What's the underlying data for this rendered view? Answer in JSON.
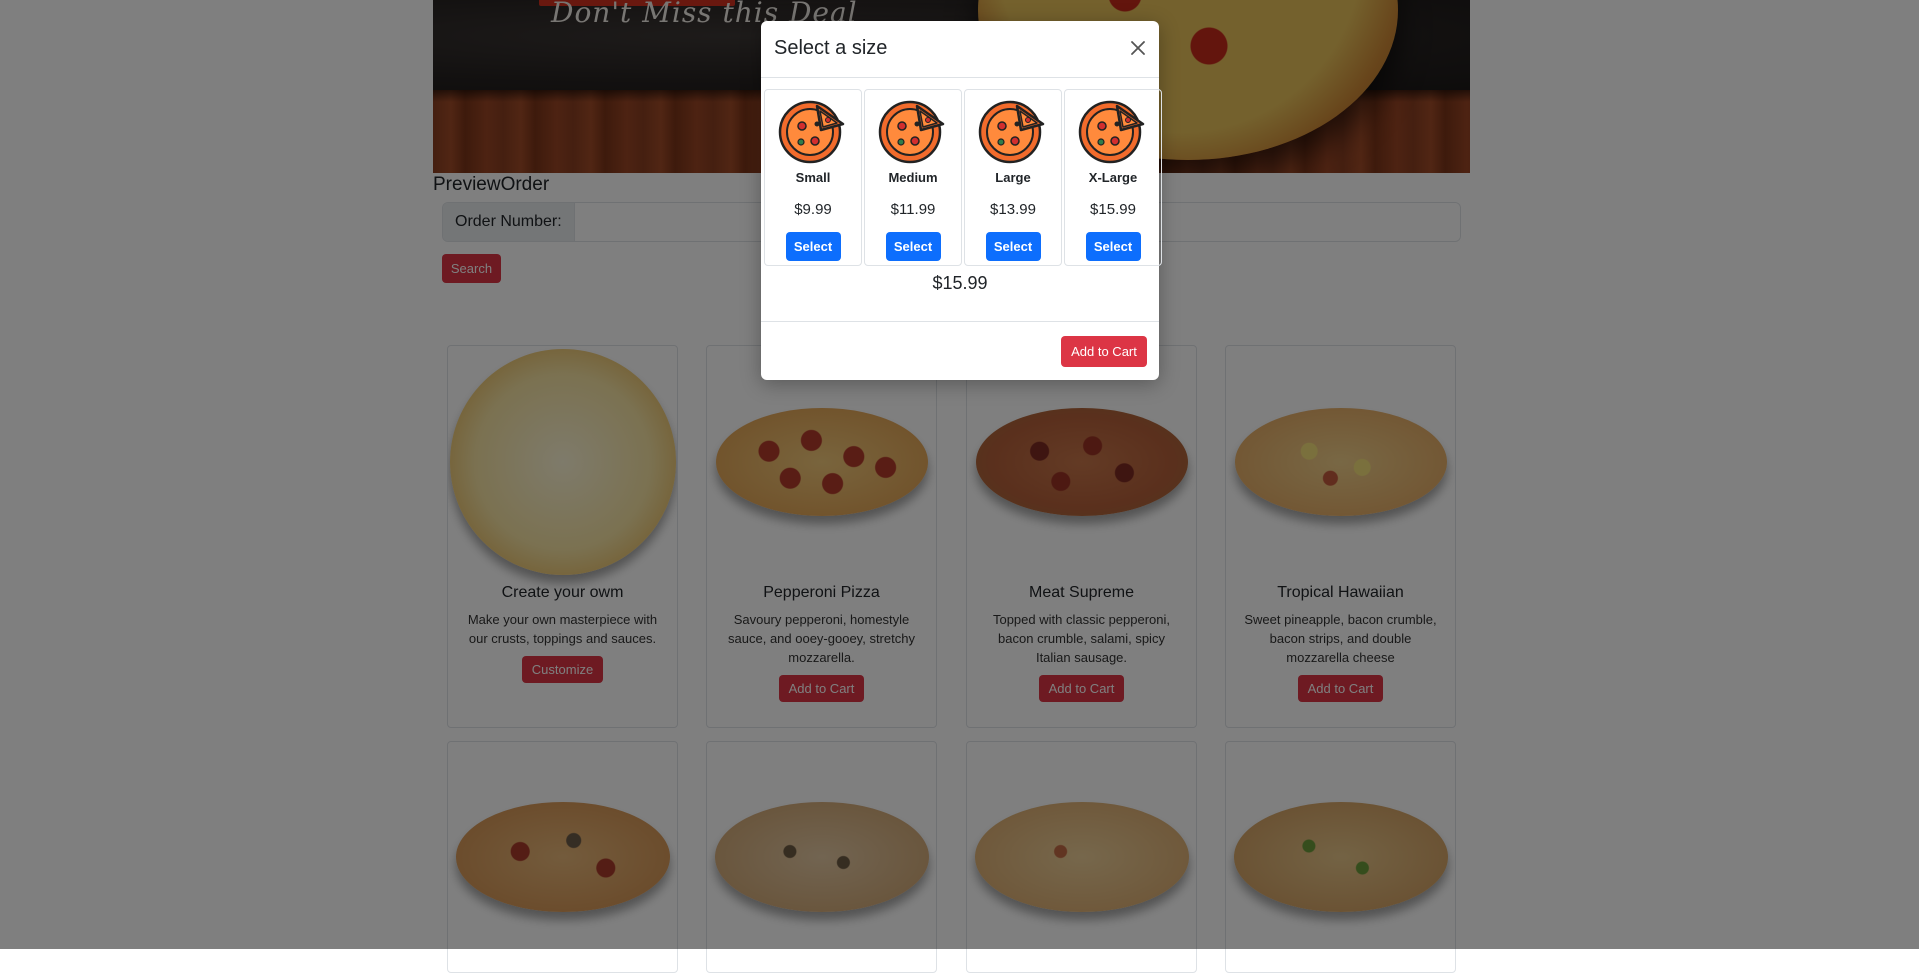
{
  "banner": {
    "tagline": "Don't Miss this Deal"
  },
  "preview": {
    "title": "PreviewOrder",
    "order_label": "Order Number:",
    "order_value": "",
    "search_label": "Search"
  },
  "products": [
    {
      "name": "Create your owm",
      "desc": "Make your own masterpiece with our crusts, toppings and sauces.",
      "button": "Customize"
    },
    {
      "name": "Pepperoni Pizza",
      "desc": "Savoury pepperoni, homestyle sauce, and ooey-gooey, stretchy mozzarella.",
      "button": "Add to Cart"
    },
    {
      "name": "Meat Supreme",
      "desc": "Topped with classic pepperoni, bacon crumble, salami, spicy Italian sausage.",
      "button": "Add to Cart"
    },
    {
      "name": "Tropical Hawaiian",
      "desc": "Sweet pineapple, bacon crumble, bacon strips, and double mozzarella cheese",
      "button": "Add to Cart"
    }
  ],
  "modal": {
    "title": "Select a size",
    "sizes": [
      {
        "name": "Small",
        "price": "$9.99",
        "button": "Select"
      },
      {
        "name": "Medium",
        "price": "$11.99",
        "button": "Select"
      },
      {
        "name": "Large",
        "price": "$13.99",
        "button": "Select"
      },
      {
        "name": "X-Large",
        "price": "$15.99",
        "button": "Select"
      }
    ],
    "total": "$15.99",
    "add_to_cart": "Add to Cart"
  },
  "colors": {
    "primary": "#0d6efd",
    "danger": "#dc3545",
    "backdrop": "rgba(0,0,0,0.5)"
  }
}
